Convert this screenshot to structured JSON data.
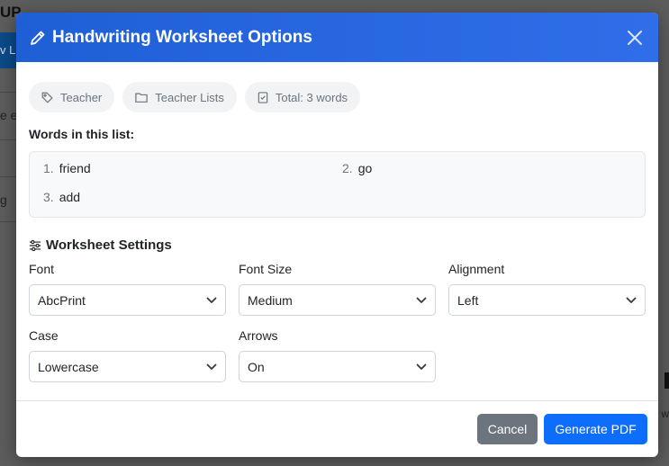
{
  "background": {
    "heading_fragment": "UP",
    "button_fragment": "v L",
    "text_fragment_1": "e ed",
    "text_fragment_2": "g",
    "right_text_fragment": "w"
  },
  "modal": {
    "title": "Handwriting Worksheet Options",
    "title_icon": "pencil-icon",
    "close_icon": "close-icon"
  },
  "chips": [
    {
      "label": "Teacher",
      "icon": "tag-icon"
    },
    {
      "label": "Teacher Lists",
      "icon": "folder-icon"
    },
    {
      "label": "Total: 3 words",
      "icon": "checklist-icon"
    }
  ],
  "words": {
    "heading": "Words in this list:",
    "items": [
      {
        "num": "1.",
        "text": "friend"
      },
      {
        "num": "2.",
        "text": "go"
      },
      {
        "num": "3.",
        "text": "add"
      }
    ]
  },
  "settings": {
    "heading": "Worksheet Settings",
    "icon": "sliders-icon",
    "fields": [
      {
        "label": "Font",
        "value": "AbcPrint"
      },
      {
        "label": "Font Size",
        "value": "Medium"
      },
      {
        "label": "Alignment",
        "value": "Left"
      },
      {
        "label": "Case",
        "value": "Lowercase"
      },
      {
        "label": "Arrows",
        "value": "On"
      }
    ]
  },
  "footer": {
    "cancel_label": "Cancel",
    "generate_label": "Generate PDF"
  },
  "colors": {
    "header": "#2563eb",
    "primary": "#0d6efd",
    "secondary": "#6c757d"
  }
}
